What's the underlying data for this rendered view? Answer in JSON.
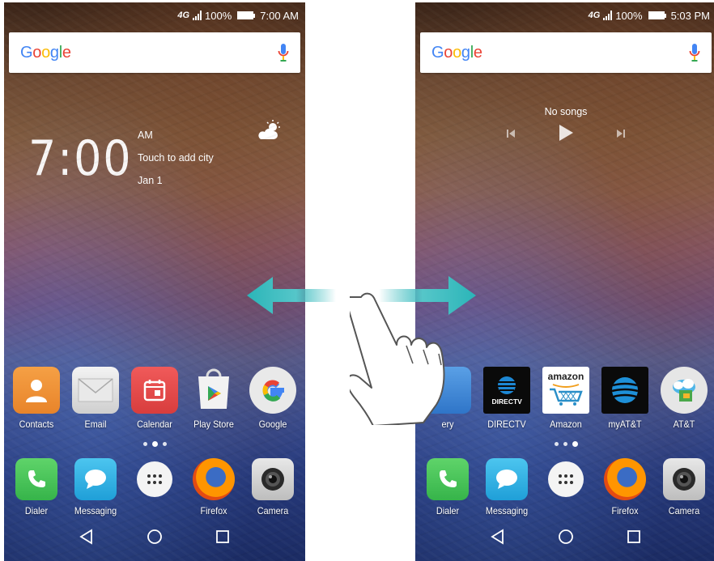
{
  "left_screen": {
    "status": {
      "network": "4G",
      "battery": "100%",
      "time": "7:00 AM"
    },
    "search": {
      "logo": "Google"
    },
    "clock": {
      "time": "7:00",
      "ampm": "AM",
      "city": "Touch to add city",
      "date": "Jan 1"
    },
    "dock_apps": [
      {
        "label": "Contacts",
        "icon": "contacts-icon"
      },
      {
        "label": "Email",
        "icon": "email-icon"
      },
      {
        "label": "Calendar",
        "icon": "calendar-icon"
      },
      {
        "label": "Play Store",
        "icon": "play-store-icon"
      },
      {
        "label": "Google",
        "icon": "google-icon"
      }
    ],
    "fixed_apps": [
      {
        "label": "Dialer",
        "icon": "phone-icon"
      },
      {
        "label": "Messaging",
        "icon": "messaging-icon"
      },
      {
        "label": "",
        "icon": "app-drawer-icon"
      },
      {
        "label": "Firefox",
        "icon": "firefox-icon"
      },
      {
        "label": "Camera",
        "icon": "camera-icon"
      }
    ]
  },
  "right_screen": {
    "status": {
      "network": "4G",
      "battery": "100%",
      "time": "5:03 PM"
    },
    "search": {
      "logo": "Google"
    },
    "music": {
      "title": "No songs"
    },
    "dock_apps": [
      {
        "label": "ery",
        "icon": "gallery-icon"
      },
      {
        "label": "DIRECTV",
        "icon": "directv-icon",
        "icon_text": "DIRECTV"
      },
      {
        "label": "Amazon",
        "icon": "amazon-icon",
        "icon_text": "amazon"
      },
      {
        "label": "myAT&T",
        "icon": "myatt-icon"
      },
      {
        "label": "AT&T",
        "icon": "att-icon"
      }
    ],
    "fixed_apps": [
      {
        "label": "Dialer",
        "icon": "phone-icon"
      },
      {
        "label": "Messaging",
        "icon": "messaging-icon"
      },
      {
        "label": "",
        "icon": "app-drawer-icon"
      },
      {
        "label": "Firefox",
        "icon": "firefox-icon"
      },
      {
        "label": "Camera",
        "icon": "camera-icon"
      }
    ]
  },
  "colors": {
    "accent_arrow": "#2bb5b8",
    "google_blue": "#4285F4",
    "google_red": "#EA4335",
    "google_yellow": "#FBBC05",
    "google_green": "#34A853"
  }
}
